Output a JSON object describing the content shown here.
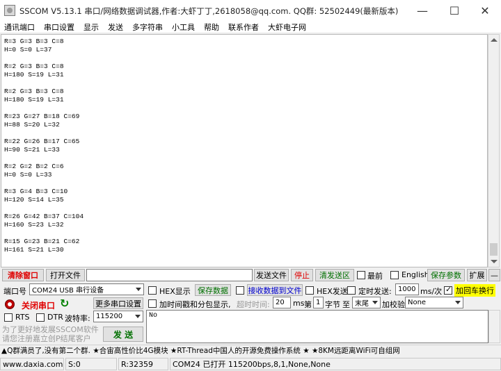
{
  "window": {
    "title": "SSCOM V5.13.1 串口/网络数据调试器,作者:大虾丁丁,2618058@qq.com. QQ群: 52502449(最新版本)",
    "minimize": "—",
    "maximize": "☐",
    "close": "✕"
  },
  "menu": [
    "通讯端口",
    "串口设置",
    "显示",
    "发送",
    "多字符串",
    "小工具",
    "帮助",
    "联系作者",
    "大虾电子网"
  ],
  "receive": {
    "lines": [
      "R=3 G=3 B=3 C=8",
      "H=0 S=0 L=37",
      "",
      "R=2 G=3 B=3 C=8",
      "H=180 S=19 L=31",
      "",
      "R=2 G=3 B=3 C=8",
      "H=180 S=19 L=31",
      "",
      "R=23 G=27 B=18 C=69",
      "H=88 S=20 L=32",
      "",
      "R=22 G=26 B=17 C=65",
      "H=90 S=21 L=33",
      "",
      "R=2 G=2 B=2 C=6",
      "H=0 S=0 L=33",
      "",
      "R=3 G=4 B=3 C=10",
      "H=120 S=14 L=35",
      "",
      "R=26 G=42 B=37 C=104",
      "H=160 S=23 L=32",
      "",
      "R=15 G=23 B=21 C=62",
      "H=161 S=21 L=30"
    ]
  },
  "toolbar": {
    "clear_window": "清除窗口",
    "open_file": "打开文件",
    "file_path": "",
    "send_file": "发送文件",
    "stop": "停止",
    "clear_send": "清发送区",
    "topmost": "最前",
    "english": "English",
    "save_params": "保存参数",
    "expand": "扩展",
    "collapse": "—"
  },
  "port": {
    "port_label": "端口号",
    "port_value": "COM24 USB 串行设备",
    "close_port": "关闭串口",
    "more_settings": "更多串口设置",
    "rts": "RTS",
    "dtr": "DTR",
    "baud_label": "波特率:",
    "baud_value": "115200",
    "promo": "为了更好地发展SSCOM软件\n请您注册嘉立创P结尾客户",
    "send": "发 送"
  },
  "options": {
    "hex_display": "HEX显示",
    "save_data": "保存数据",
    "recv_to_file": "接收数据到文件",
    "hex_send": "HEX发送",
    "timed_send": "定时发送:",
    "timed_value": "1000",
    "timed_unit": "ms/次",
    "append_crlf": "加回车换行",
    "timestamp": "加时间戳和分包显示,",
    "timeout_label": "超时时间:",
    "timeout_value": "20",
    "timeout_unit": "ms",
    "byte_prefix": "第",
    "byte_value": "1",
    "byte_unit": "字节",
    "to": "至",
    "tail_value": "末尾",
    "checksum_label": "加校验",
    "checksum_value": "None"
  },
  "send_text": "No",
  "ticker": "▲Q群满员了,没有第二个群. ★合宙高性价比4G模块 ★RT-Thread中国人的开源免费操作系统 ★ ★8KM远距离WiFi可自组网",
  "status": {
    "website": "www.daxia.com",
    "sent": "S:0",
    "received": "R:32359",
    "port_status": "COM24 已打开  115200bps,8,1,None,None"
  }
}
